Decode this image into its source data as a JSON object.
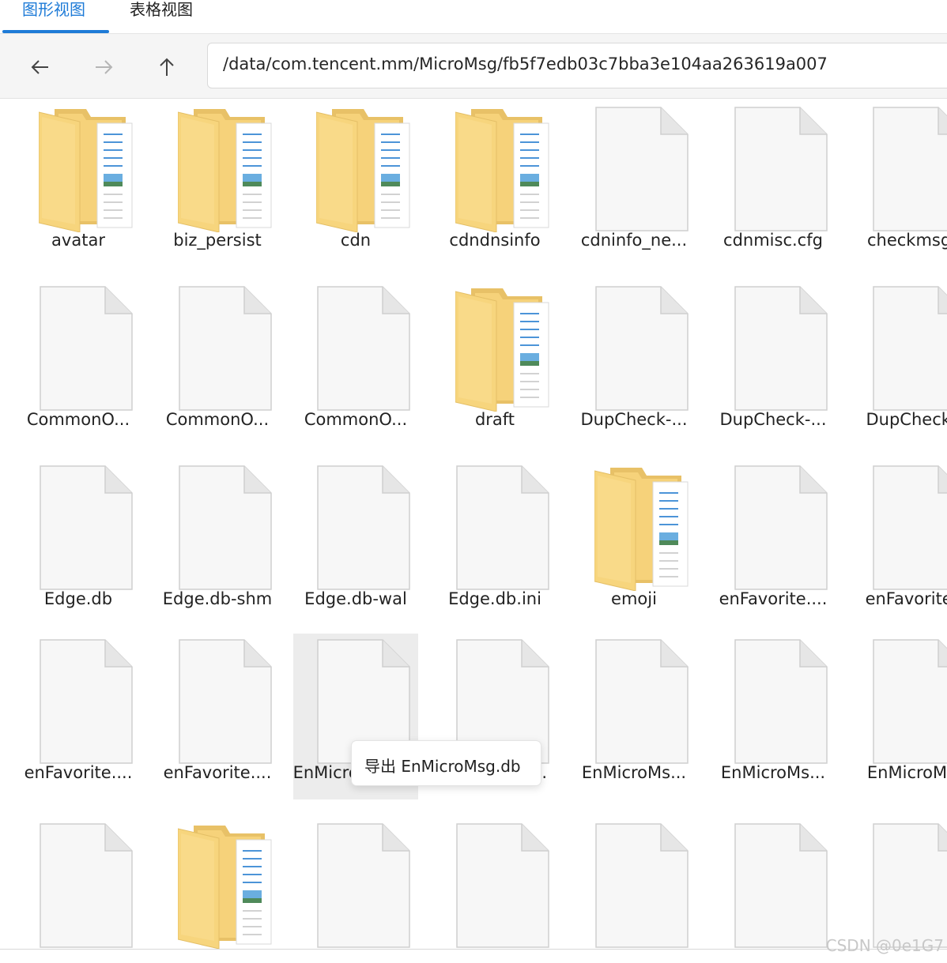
{
  "tabs": [
    {
      "label": "图形视图",
      "active": true
    },
    {
      "label": "表格视图",
      "active": false
    }
  ],
  "toolbar": {
    "back_icon": "arrow-left-icon",
    "forward_icon": "arrow-right-icon",
    "up_icon": "arrow-up-icon",
    "path": "/data/com.tencent.mm/MicroMsg/fb5f7edb03c7bba3e104aa263619a007"
  },
  "files": [
    {
      "name": "avatar",
      "type": "folder"
    },
    {
      "name": "biz_persist",
      "type": "folder"
    },
    {
      "name": "cdn",
      "type": "folder"
    },
    {
      "name": "cdndnsinfo",
      "type": "folder"
    },
    {
      "name": "cdninfo_ne...",
      "type": "file"
    },
    {
      "name": "cdnmisc.cfg",
      "type": "file"
    },
    {
      "name": "checkmsgi",
      "type": "file"
    },
    {
      "name": "CommonO...",
      "type": "file"
    },
    {
      "name": "CommonO...",
      "type": "file"
    },
    {
      "name": "CommonO...",
      "type": "file"
    },
    {
      "name": "draft",
      "type": "folder"
    },
    {
      "name": "DupCheck-...",
      "type": "file"
    },
    {
      "name": "DupCheck-...",
      "type": "file"
    },
    {
      "name": "DupCheck-",
      "type": "file"
    },
    {
      "name": "Edge.db",
      "type": "file"
    },
    {
      "name": "Edge.db-shm",
      "type": "file"
    },
    {
      "name": "Edge.db-wal",
      "type": "file"
    },
    {
      "name": "Edge.db.ini",
      "type": "file"
    },
    {
      "name": "emoji",
      "type": "folder"
    },
    {
      "name": "enFavorite....",
      "type": "file"
    },
    {
      "name": "enFavorite.",
      "type": "file"
    },
    {
      "name": "enFavorite....",
      "type": "file"
    },
    {
      "name": "enFavorite....",
      "type": "file"
    },
    {
      "name": "EnMicroMsg.db",
      "type": "file",
      "selected": true
    },
    {
      "name": "EnMicroMs...",
      "type": "file"
    },
    {
      "name": "EnMicroMs...",
      "type": "file"
    },
    {
      "name": "EnMicroMs...",
      "type": "file"
    },
    {
      "name": "EnMicroMs",
      "type": "file"
    },
    {
      "name": "",
      "type": "file"
    },
    {
      "name": "",
      "type": "folder"
    },
    {
      "name": "",
      "type": "file"
    },
    {
      "name": "",
      "type": "file"
    },
    {
      "name": "",
      "type": "file"
    },
    {
      "name": "",
      "type": "file"
    },
    {
      "name": "",
      "type": "file"
    }
  ],
  "tooltip": {
    "text": "导出 EnMicroMsg.db"
  },
  "watermark": "CSDN @0e1G7"
}
